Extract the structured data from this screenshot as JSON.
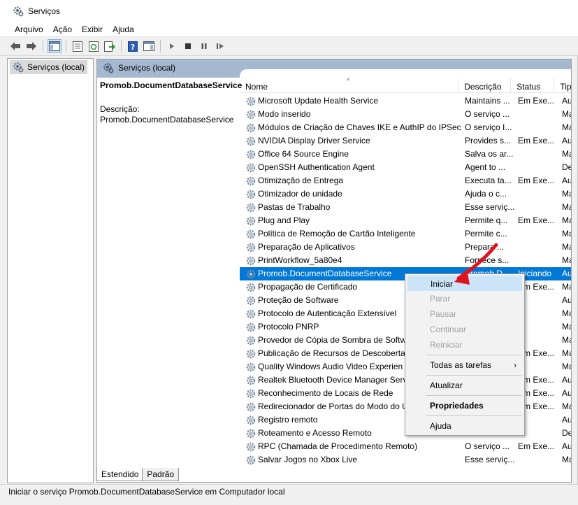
{
  "window": {
    "title": "Serviços"
  },
  "menu": [
    "Arquivo",
    "Ação",
    "Exibir",
    "Ajuda"
  ],
  "tree": {
    "item": "Serviços (local)"
  },
  "content_header": "Serviços (local)",
  "desc": {
    "title": "Promob.DocumentDatabaseService",
    "label": "Descrição:",
    "value": "Promob.DocumentDatabaseService"
  },
  "columns": {
    "name": "Nome",
    "desc": "Descrição",
    "status": "Status",
    "type": "Tip"
  },
  "rows": [
    {
      "name": "Microsoft Update Health Service",
      "desc": "Maintains ...",
      "status": "Em Exe...",
      "type": "Au"
    },
    {
      "name": "Modo inserido",
      "desc": "O serviço ...",
      "status": "",
      "type": "Ma"
    },
    {
      "name": "Módulos de Criação de Chaves IKE e AuthIP do IPSec",
      "desc": "O serviço I...",
      "status": "",
      "type": "Ma"
    },
    {
      "name": "NVIDIA Display Driver Service",
      "desc": "Provides s...",
      "status": "Em Exe...",
      "type": "Au"
    },
    {
      "name": "Office 64 Source Engine",
      "desc": "Salva os ar...",
      "status": "",
      "type": "Ma"
    },
    {
      "name": "OpenSSH Authentication Agent",
      "desc": "Agent to ...",
      "status": "",
      "type": "De"
    },
    {
      "name": "Otimização de Entrega",
      "desc": "Executa ta...",
      "status": "Em Exe...",
      "type": "Au"
    },
    {
      "name": "Otimizador de unidade",
      "desc": "Ajuda o c...",
      "status": "",
      "type": "Ma"
    },
    {
      "name": "Pastas de Trabalho",
      "desc": "Esse serviç...",
      "status": "",
      "type": "Ma"
    },
    {
      "name": "Plug and Play",
      "desc": "Permite q...",
      "status": "Em Exe...",
      "type": "Ma"
    },
    {
      "name": "Política de Remoção de Cartão Inteligente",
      "desc": "Permite c...",
      "status": "",
      "type": "Ma"
    },
    {
      "name": "Preparação de Aplicativos",
      "desc": "Prepara ...",
      "status": "",
      "type": "Ma"
    },
    {
      "name": "PrintWorkflow_5a80e4",
      "desc": "Fornece s...",
      "status": "",
      "type": "Ma"
    },
    {
      "name": "Promob.DocumentDatabaseService",
      "desc": "Promob.D...",
      "status": "Iniciando",
      "type": "Au"
    },
    {
      "name": "Propagação de Certificado",
      "desc": "",
      "status": "Em Exe...",
      "type": "Ma"
    },
    {
      "name": "Proteção de Software",
      "desc": "",
      "status": "",
      "type": "Au"
    },
    {
      "name": "Protocolo de Autenticação Extensível",
      "desc": "",
      "status": "",
      "type": "Ma"
    },
    {
      "name": "Protocolo PNRP",
      "desc": "",
      "status": "",
      "type": "Ma"
    },
    {
      "name": "Provedor de Cópia de Sombra de Softw",
      "desc": "",
      "status": "",
      "type": "Ma"
    },
    {
      "name": "Publicação de Recursos de Descoberta",
      "desc": "",
      "status": "Em Exe...",
      "type": "Ma"
    },
    {
      "name": "Quality Windows Audio Video Experien",
      "desc": "",
      "status": "",
      "type": "Ma"
    },
    {
      "name": "Realtek Bluetooth Device Manager Serv",
      "desc": "",
      "status": "Em Exe...",
      "type": "Au"
    },
    {
      "name": "Reconhecimento de Locais de Rede",
      "desc": "",
      "status": "Em Exe...",
      "type": "Au"
    },
    {
      "name": "Redirecionador de Portas do Modo do U",
      "desc": "",
      "status": "Em Exe...",
      "type": "Ma"
    },
    {
      "name": "Registro remoto",
      "desc": "",
      "status": "",
      "type": "Au"
    },
    {
      "name": "Roteamento e Acesso Remoto",
      "desc": "",
      "status": "",
      "type": "De"
    },
    {
      "name": "RPC (Chamada de Procedimento Remoto)",
      "desc": "O serviço ...",
      "status": "Em Exe...",
      "type": "Au"
    },
    {
      "name": "Salvar Jogos no Xbox Live",
      "desc": "Esse serviç...",
      "status": "",
      "type": "Ma"
    }
  ],
  "selected_index": 13,
  "context_menu": {
    "start": "Iniciar",
    "stop": "Parar",
    "pause": "Pausar",
    "resume": "Continuar",
    "restart": "Reiniciar",
    "all_tasks": "Todas as tarefas",
    "refresh": "Atualizar",
    "properties": "Propriedades",
    "help": "Ajuda"
  },
  "tabs": [
    "Estendido",
    "Padrão"
  ],
  "status_text": "Iniciar o serviço Promob.DocumentDatabaseService em Computador local",
  "colors": {
    "selection": "#0078d7",
    "header": "#a4b9d0",
    "menu_highlight": "#cce4f7",
    "annotation_arrow": "#e0141e"
  }
}
